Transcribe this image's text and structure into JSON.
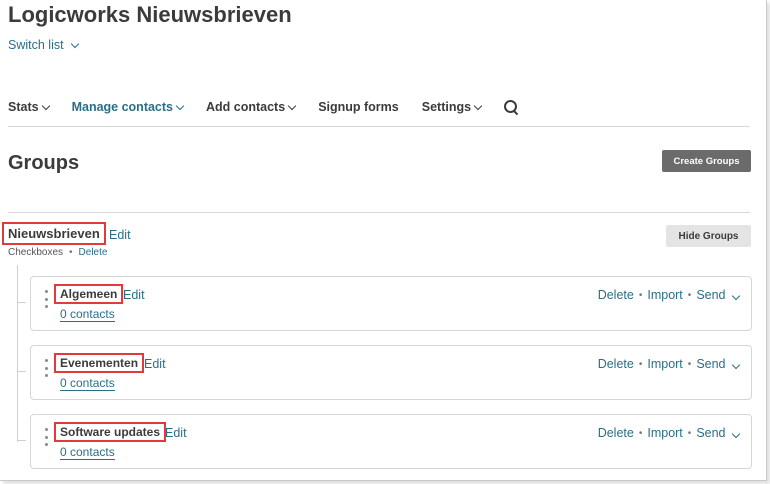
{
  "header": {
    "title": "Logicworks Nieuwsbrieven",
    "switch_label": "Switch list"
  },
  "nav": {
    "items": [
      {
        "label": "Stats",
        "has_dropdown": true,
        "active": false
      },
      {
        "label": "Manage contacts",
        "has_dropdown": true,
        "active": true
      },
      {
        "label": "Add contacts",
        "has_dropdown": true,
        "active": false
      },
      {
        "label": "Signup forms",
        "has_dropdown": false,
        "active": false
      },
      {
        "label": "Settings",
        "has_dropdown": true,
        "active": false
      }
    ],
    "search_icon": "search-icon"
  },
  "groups_page": {
    "heading": "Groups",
    "create_button": "Create Groups",
    "hide_button": "Hide Groups"
  },
  "parent_group": {
    "name": "Nieuwsbrieven",
    "edit_label": "Edit",
    "type": "Checkboxes",
    "separator": "•",
    "delete_label": "Delete"
  },
  "groups": [
    {
      "name": "Algemeen",
      "edit_label": "Edit",
      "contacts": "0 contacts",
      "delete": "Delete",
      "import": "Import",
      "send": "Send"
    },
    {
      "name": "Evenementen",
      "edit_label": "Edit",
      "contacts": "0 contacts",
      "delete": "Delete",
      "import": "Import",
      "send": "Send"
    },
    {
      "name": "Software updates",
      "edit_label": "Edit",
      "contacts": "0 contacts",
      "delete": "Delete",
      "import": "Import",
      "send": "Send"
    }
  ],
  "colors": {
    "accent": "#2b6f86",
    "text": "#3b3b3b",
    "highlight": "#e03a3a",
    "create_button_bg": "#6b6b6b",
    "hide_button_bg": "#e4e4e4"
  }
}
